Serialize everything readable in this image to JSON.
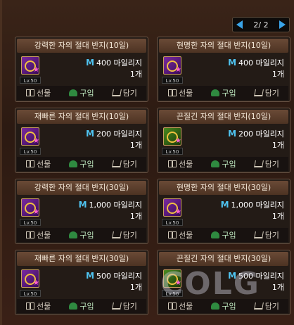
{
  "pager": {
    "text": "2/ 2"
  },
  "items": [
    {
      "title": "강력한 자의 절대 반지(10일)",
      "mileage": "400 마일리지",
      "qty": "1개",
      "level": "Lv.50",
      "gift": "선물",
      "buy": "구입",
      "cart": "담기",
      "icon_color": "purple"
    },
    {
      "title": "현명한 자의 절대 반지(10일)",
      "mileage": "400 마일리지",
      "qty": "1개",
      "level": "Lv.50",
      "gift": "선물",
      "buy": "구입",
      "cart": "담기",
      "icon_color": "purple"
    },
    {
      "title": "재빠른 자의 절대 반지(10일)",
      "mileage": "200 마일리지",
      "qty": "1개",
      "level": "Lv.50",
      "gift": "선물",
      "buy": "구입",
      "cart": "담기",
      "icon_color": "purple"
    },
    {
      "title": "끈질긴 자의 절대 반지(10일)",
      "mileage": "200 마일리지",
      "qty": "1개",
      "level": "Lv.50",
      "gift": "선물",
      "buy": "구입",
      "cart": "담기",
      "icon_color": "green"
    },
    {
      "title": "강력한 자의 절대 반지(30일)",
      "mileage": "1,000 마일리지",
      "qty": "1개",
      "level": "Lv.50",
      "gift": "선물",
      "buy": "구입",
      "cart": "담기",
      "icon_color": "purple"
    },
    {
      "title": "현명한 자의 절대 반지(30일)",
      "mileage": "1,000 마일리지",
      "qty": "1개",
      "level": "Lv.50",
      "gift": "선물",
      "buy": "구입",
      "cart": "담기",
      "icon_color": "purple"
    },
    {
      "title": "재빠른 자의 절대 반지(30일)",
      "mileage": "500 마일리지",
      "qty": "1개",
      "level": "Lv.50",
      "gift": "선물",
      "buy": "구입",
      "cart": "담기",
      "icon_color": "purple"
    },
    {
      "title": "끈질긴 자의 절대 반지(30일)",
      "mileage": "500 마일리지",
      "qty": "1개",
      "level": "Lv.50",
      "gift": "선물",
      "buy": "구입",
      "cart": "담기",
      "icon_color": "green"
    }
  ],
  "watermark": "COLG",
  "colors": {
    "accent": "#3aa4e8",
    "mileage_icon": "#4fc3f0",
    "card_border": "#6a5444"
  }
}
